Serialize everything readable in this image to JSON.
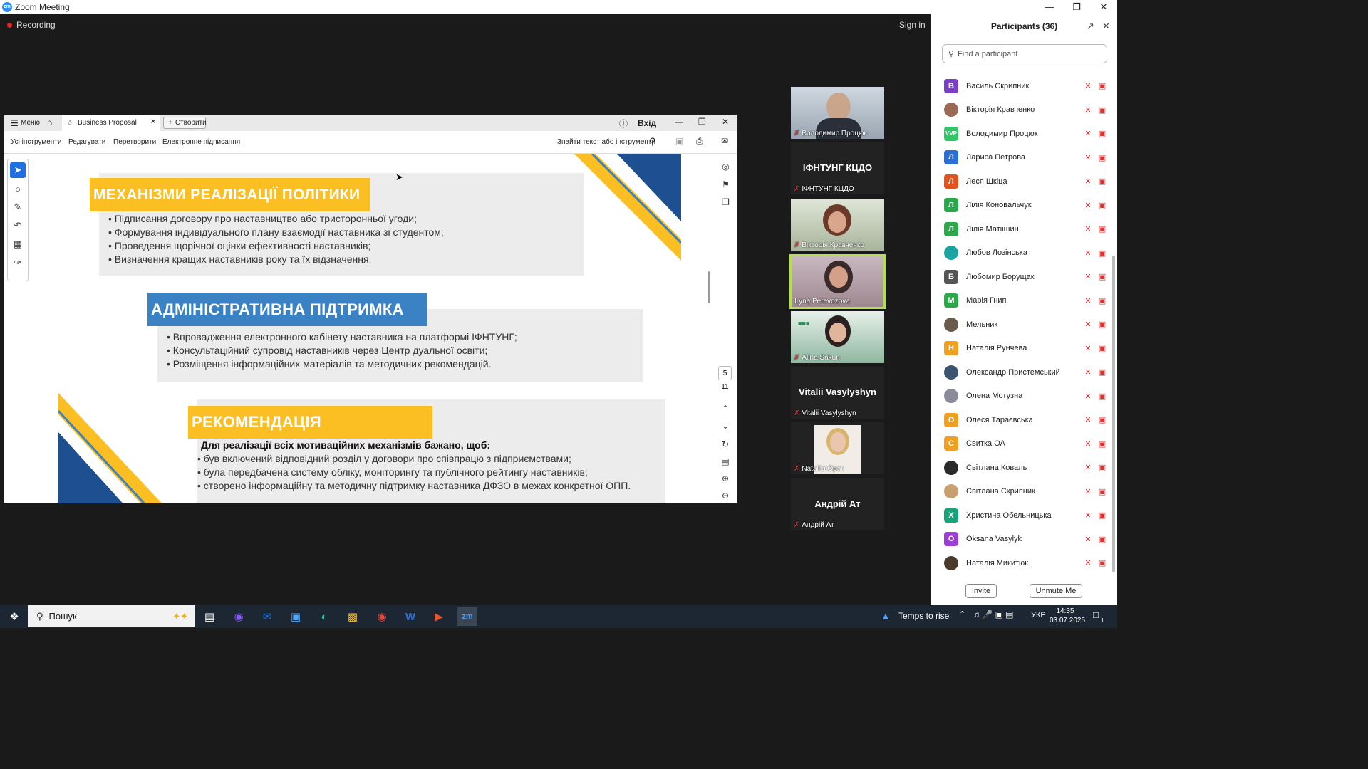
{
  "window": {
    "title": "Zoom Meeting"
  },
  "meeting": {
    "recording_label": "Recording",
    "signin_label": "Sign in"
  },
  "shared": {
    "menu_label": "Меню",
    "tab_title": "Business Proposal",
    "create_label": "Створити",
    "login_label": "Вхід",
    "toolbar": {
      "all_tools": "Усі інструменти",
      "edit": "Редагувати",
      "convert": "Перетворити",
      "esign": "Електронне підписання",
      "search": "Знайти текст або інструменти"
    },
    "page_current": "5",
    "page_total": "11",
    "slide": {
      "s1_title": "МЕХАНІЗМИ РЕАЛІЗАЦІЇ ПОЛІТИКИ",
      "s1_items": [
        "Підписання договору про наставництво або тристоронньої угоди;",
        "Формування індивідуального плану взаємодії наставника зі студентом;",
        "Проведення щорічної оцінки ефективності наставників;",
        "Визначення кращих наставників року та їх відзначення."
      ],
      "s2_title": "АДМІНІСТРАТИВНА ПІДТРИМКА",
      "s2_items": [
        "Впровадження електронного кабінету наставника на платформі ІФНТУНГ;",
        "Консультаційний супровід наставників через Центр дуальної освіти;",
        "Розміщення інформаційних матеріалів та методичних рекомендацій."
      ],
      "s3_title": "РЕКОМЕНДАЦІЯ",
      "s3_lead": "Для реалізації всіх мотиваційних механізмів бажано, щоб:",
      "s3_items": [
        "був включений відповідний розділ у договори про співпрацю з підприємствами;",
        "була передбачена систему обліку, моніторингу та публічного рейтингу наставників;",
        "створено інформаційну та методичну підтримку наставника ДФЗО в межах конкретної ОПП."
      ]
    }
  },
  "videos": [
    {
      "name": "Володимир Процюк",
      "type": "video"
    },
    {
      "name": "ІФНТУНГ КЦДО",
      "type": "name"
    },
    {
      "name": "Вікторія Кравченко",
      "type": "video"
    },
    {
      "name": "Iryna Perevozova",
      "type": "video"
    },
    {
      "name": "Alina Sakun",
      "type": "video"
    },
    {
      "name": "Vitalii Vasylyshyn",
      "type": "name"
    },
    {
      "name": "Nataliia Opar",
      "type": "video"
    },
    {
      "name": "Андрій Ат",
      "type": "name"
    }
  ],
  "participants": {
    "title": "Participants (36)",
    "search_placeholder": "Find a participant",
    "list": [
      {
        "name": "Василь Скрипник",
        "initial": "В",
        "color": "#7b3fc4"
      },
      {
        "name": "Вікторія Кравченко",
        "initial": "",
        "color": "#9a6a55"
      },
      {
        "name": "Володимир Процюк",
        "initial": "VVP",
        "color": "#33c46a"
      },
      {
        "name": "Лариса Петрова",
        "initial": "Л",
        "color": "#2a6fd6"
      },
      {
        "name": "Леся Шкіца",
        "initial": "Л",
        "color": "#e0521e"
      },
      {
        "name": "Лілія Коновальчук",
        "initial": "Л",
        "color": "#2aa84a"
      },
      {
        "name": "Лілія Матіішин",
        "initial": "Л",
        "color": "#2aa84a"
      },
      {
        "name": "Любов Лозінська",
        "initial": "",
        "color": "#1aa3a3"
      },
      {
        "name": "Любомир Борущак",
        "initial": "Б",
        "color": "#555555"
      },
      {
        "name": "Марія Гнип",
        "initial": "М",
        "color": "#2aa84a"
      },
      {
        "name": "Мельник",
        "initial": "",
        "color": "#6b5b4b"
      },
      {
        "name": "Наталія Рунчева",
        "initial": "Н",
        "color": "#f0a020"
      },
      {
        "name": "Олександр Пристемський",
        "initial": "",
        "color": "#3b5570"
      },
      {
        "name": "Олена Мотузна",
        "initial": "",
        "color": "#8a8a9a"
      },
      {
        "name": "Олеся Тараєвська",
        "initial": "О",
        "color": "#f0a020"
      },
      {
        "name": "Свитка ОА",
        "initial": "С",
        "color": "#f0a020"
      },
      {
        "name": "Світлана Коваль",
        "initial": "",
        "color": "#2a2a2a"
      },
      {
        "name": "Світлана Скрипник",
        "initial": "",
        "color": "#c8a070"
      },
      {
        "name": "Христина Обельницька",
        "initial": "Х",
        "color": "#1aa37a"
      },
      {
        "name": "Oksana Vasylyk",
        "initial": "О",
        "color": "#9b3fd4"
      },
      {
        "name": "Наталія Микитюк",
        "initial": "",
        "color": "#4a3a2a"
      }
    ],
    "invite_label": "Invite",
    "unmute_label": "Unmute Me"
  },
  "taskbar": {
    "search_placeholder": "Пошук",
    "weather": "Temps to rise",
    "lang": "УКР",
    "time": "14:35",
    "date": "03.07.2025",
    "notif_count": "1"
  },
  "colors": {
    "accent_blue": "#2d8cff",
    "slide_yellow": "#fbbf24",
    "slide_blue": "#3b82c4",
    "slide_navy": "#1d4f91"
  }
}
